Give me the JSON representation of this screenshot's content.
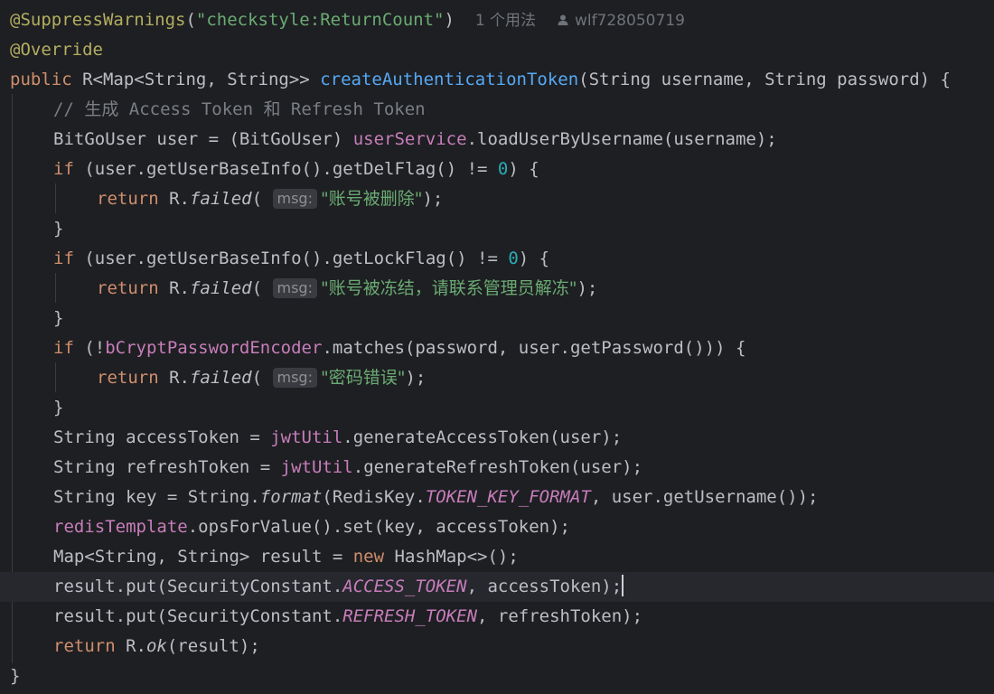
{
  "editor": {
    "annotation_suppress": "@SuppressWarnings",
    "annotation_arg": "\"checkstyle:ReturnCount\"",
    "usage_hint": "1 个用法",
    "author_hint": "wlf728050719",
    "annotation_override": "@Override",
    "inlay_msg": "msg:",
    "method_name": "createAuthenticationToken",
    "comment": "// 生成 Access Token 和 Refresh Token",
    "str_deleted": "\"账号被删除\"",
    "str_frozen": "\"账号被冻结，请联系管理员解冻\"",
    "str_password": "\"密码错误\"",
    "theme": {
      "background": "#1e1f22",
      "keyword": "#cf8e6d",
      "string": "#6aab73",
      "function": "#56a8f5",
      "field": "#c77dbb",
      "number": "#2aacb8",
      "comment": "#7a7e85",
      "annotation": "#b3ae60"
    }
  }
}
